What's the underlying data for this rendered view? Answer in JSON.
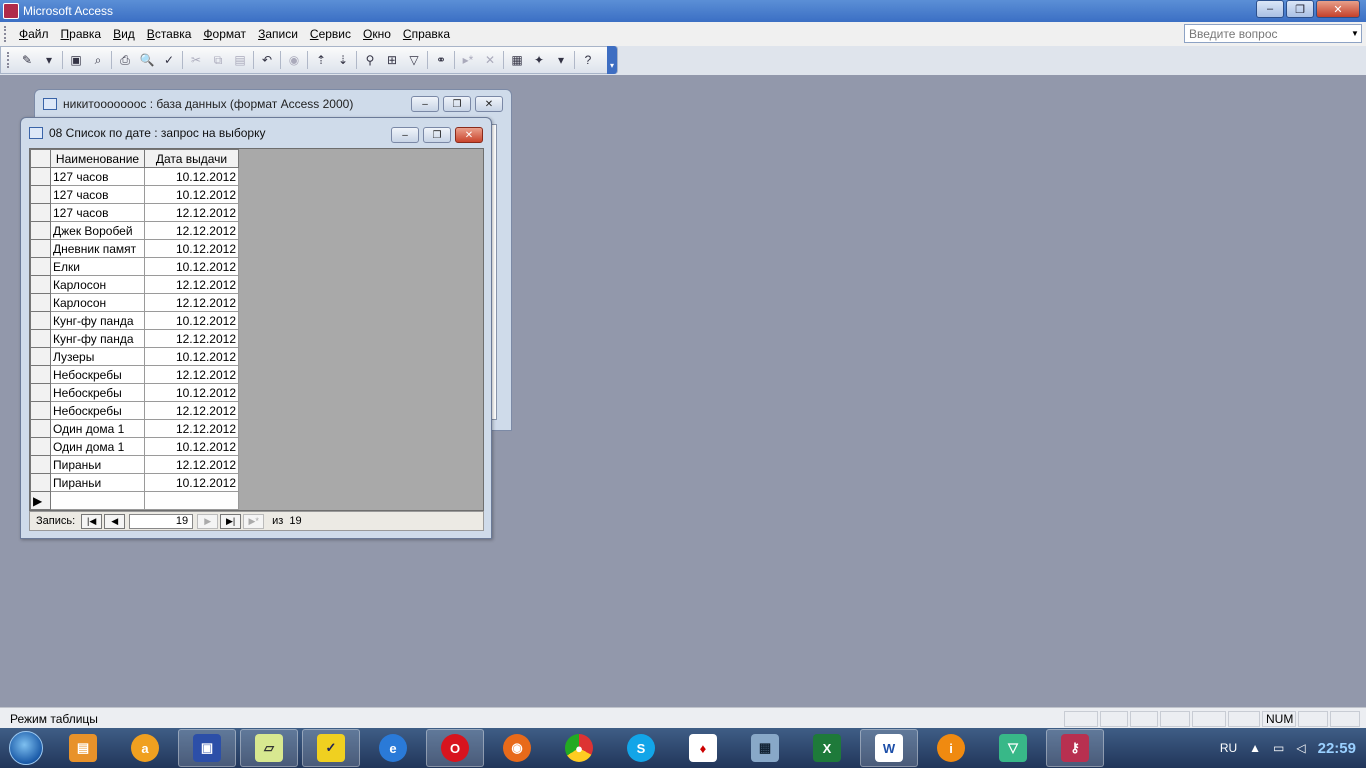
{
  "app": {
    "title": "Microsoft Access"
  },
  "window_buttons": {
    "minimize": "‒",
    "restore": "❐",
    "close": "✕"
  },
  "menu": [
    "Файл",
    "Правка",
    "Вид",
    "Вставка",
    "Формат",
    "Записи",
    "Сервис",
    "Окно",
    "Справка"
  ],
  "ask_box": {
    "placeholder": "Введите вопрос"
  },
  "toolbar_icons": [
    "view-icon",
    "save-icon",
    "search-file-icon",
    "print-icon",
    "print-preview-icon",
    "spelling-icon",
    "cut-icon",
    "copy-icon",
    "paste-icon",
    "undo-icon",
    "hyperlink-icon",
    "sort-asc-icon",
    "sort-desc-icon",
    "filter-selection-icon",
    "filter-form-icon",
    "apply-filter-icon",
    "find-icon",
    "new-record-icon",
    "delete-record-icon",
    "database-window-icon",
    "new-object-icon",
    "help-icon"
  ],
  "db_window": {
    "title": "никитооооооос : база данных (формат Access 2000)"
  },
  "query_window": {
    "title": "08 Список по дате : запрос на выборку",
    "columns": [
      "Наименование",
      "Дата выдачи"
    ],
    "rows": [
      [
        "127 часов",
        "10.12.2012"
      ],
      [
        "127 часов",
        "10.12.2012"
      ],
      [
        "127 часов",
        "12.12.2012"
      ],
      [
        "Джек Воробей",
        "12.12.2012"
      ],
      [
        "Дневник памят",
        "10.12.2012"
      ],
      [
        "Елки",
        "10.12.2012"
      ],
      [
        "Карлосон",
        "12.12.2012"
      ],
      [
        "Карлосон",
        "12.12.2012"
      ],
      [
        "Кунг-фу панда",
        "10.12.2012"
      ],
      [
        "Кунг-фу панда",
        "12.12.2012"
      ],
      [
        "Лузеры",
        "10.12.2012"
      ],
      [
        "Небоскребы",
        "12.12.2012"
      ],
      [
        "Небоскребы",
        "10.12.2012"
      ],
      [
        "Небоскребы",
        "12.12.2012"
      ],
      [
        "Один дома 1",
        "12.12.2012"
      ],
      [
        "Один дома 1",
        "10.12.2012"
      ],
      [
        "Пираньи",
        "12.12.2012"
      ],
      [
        "Пираньи",
        "10.12.2012"
      ]
    ],
    "nav": {
      "label": "Запись:",
      "current": "19",
      "of_label": "из",
      "total": "19"
    }
  },
  "status": {
    "mode": "Режим таблицы",
    "num": "NUM"
  },
  "taskbar": {
    "apps": [
      "files-icon",
      "avast-icon",
      "save-disk-icon",
      "notes-icon",
      "check-app-icon",
      "internet-explorer-icon",
      "opera-icon",
      "firefox-icon",
      "chrome-icon",
      "skype-icon",
      "solitaire-icon",
      "calendar-icon",
      "excel-icon",
      "word-icon",
      "info-icon",
      "vector-icon",
      "access-icon"
    ],
    "lang": "RU",
    "time": "22:59"
  }
}
